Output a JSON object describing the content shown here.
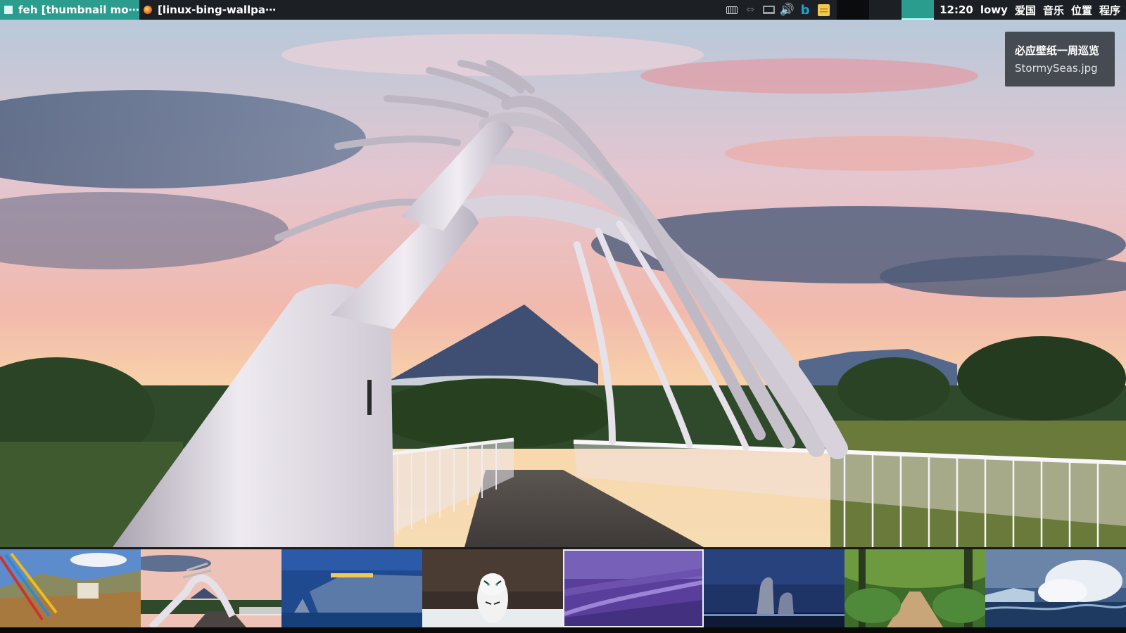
{
  "taskbar": {
    "tasks": [
      {
        "label": "feh [thumbnail mo⋯",
        "icon": "terminal-icon",
        "active": true
      },
      {
        "label": "[linux-bing-wallpa⋯",
        "icon": "firefox-icon",
        "active": false
      }
    ],
    "tray_icons": [
      "keyboard-icon",
      "network-arrows-icon",
      "monitor-icon",
      "volume-icon",
      "bing-icon",
      "sticky-note-icon"
    ],
    "clock": "12:20",
    "user": "lowy",
    "menus": [
      "爱国",
      "音乐",
      "位置",
      "程序"
    ],
    "accent": "#2a9d8f"
  },
  "notification": {
    "title": "必应壁纸一周巡览",
    "body": "StormySeas.jpg"
  },
  "thumbnails": [
    {
      "name": "prayer-flags-monastery",
      "selected": false
    },
    {
      "name": "white-bridge-mountain",
      "selected": false
    },
    {
      "name": "coastal-cliffs-town",
      "selected": false
    },
    {
      "name": "white-tiger-snow",
      "selected": false
    },
    {
      "name": "purple-aerial-valley",
      "selected": true
    },
    {
      "name": "kelpies-horse-sculptures",
      "selected": false
    },
    {
      "name": "forest-path-trees",
      "selected": false
    },
    {
      "name": "stormy-seas-iceberg",
      "selected": false
    }
  ]
}
